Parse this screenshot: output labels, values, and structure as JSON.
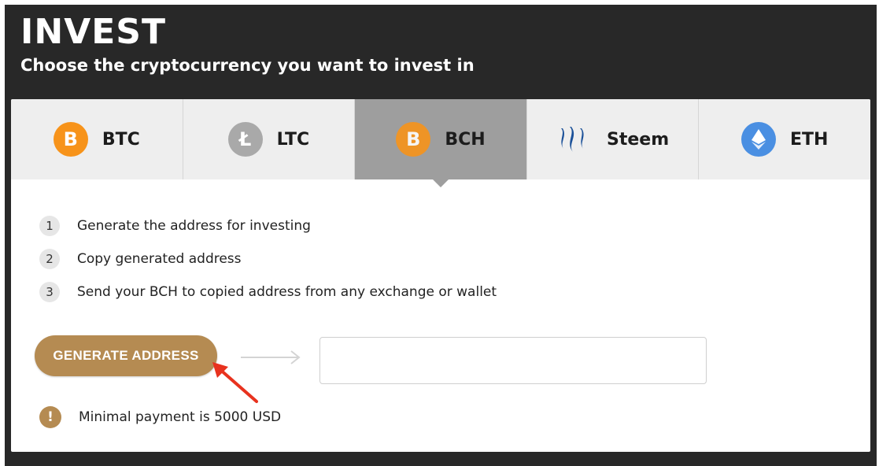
{
  "header": {
    "title": "INVEST",
    "subtitle": "Choose the cryptocurrency you want to invest in"
  },
  "tabs": [
    {
      "label": "BTC",
      "icon": "bitcoin-icon",
      "glyph": "B",
      "active": false
    },
    {
      "label": "LTC",
      "icon": "litecoin-icon",
      "glyph": "Ł",
      "active": false
    },
    {
      "label": "BCH",
      "icon": "bitcoin-cash-icon",
      "glyph": "B",
      "active": true
    },
    {
      "label": "Steem",
      "icon": "steem-icon",
      "glyph": "",
      "active": false
    },
    {
      "label": "ETH",
      "icon": "ethereum-icon",
      "glyph": "",
      "active": false
    }
  ],
  "steps": [
    {
      "num": "1",
      "text": "Generate the address for investing"
    },
    {
      "num": "2",
      "text": "Copy generated address"
    },
    {
      "num": "3",
      "text": "Send your BCH to copied address from any exchange or wallet"
    }
  ],
  "actions": {
    "generate_label": "GENERATE ADDRESS",
    "address_value": ""
  },
  "notice": {
    "icon_glyph": "!",
    "text": "Minimal payment is 5000 USD"
  },
  "colors": {
    "accent": "#b58b52",
    "header_bg": "#282828",
    "active_tab": "#9e9e9e",
    "btc": "#f7931a",
    "eth": "#4a8fe2",
    "steem": "#1a5099",
    "annotation_arrow": "#e8321e"
  }
}
